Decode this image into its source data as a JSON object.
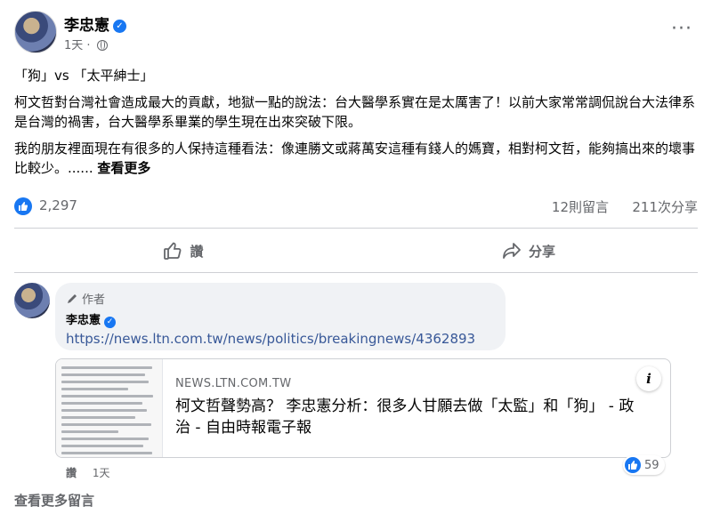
{
  "post": {
    "author": "李忠憲",
    "time": "1天",
    "more": "···",
    "title_line": "「狗」vs 「太平紳士」",
    "paragraph1": "柯文哲對台灣社會造成最大的貢獻，地獄一點的說法：台大醫學系實在是太厲害了！以前大家常常調侃說台大法律系是台灣的禍害，台大醫學系畢業的學生現在出來突破下限。",
    "paragraph2": "我的朋友裡面現在有很多的人保持這種看法：像連勝文或蔣萬安這種有錢人的媽寶，相對柯文哲，能夠搞出來的壞事比較少。......",
    "see_more": "查看更多"
  },
  "stats": {
    "likes": "2,297",
    "comments": "12則留言",
    "shares": "211次分享"
  },
  "actions": {
    "like": "讚",
    "share": "分享"
  },
  "comment": {
    "author_tag": "作者",
    "author": "李忠憲",
    "link": "https://news.ltn.com.tw/news/politics/breakingnews/4362893",
    "preview_domain": "NEWS.LTN.COM.TW",
    "preview_title": "柯文哲聲勢高？ 李忠憲分析：很多人甘願去做「太監」和「狗」 - 政治 - 自由時報電子報",
    "info": "i",
    "like_action": "讚",
    "time": "1天",
    "reaction_count": "59"
  },
  "footer": {
    "view_more": "查看更多留言"
  },
  "colors": {
    "accent": "#1877f2",
    "muted": "#65676b",
    "link": "#385898"
  }
}
